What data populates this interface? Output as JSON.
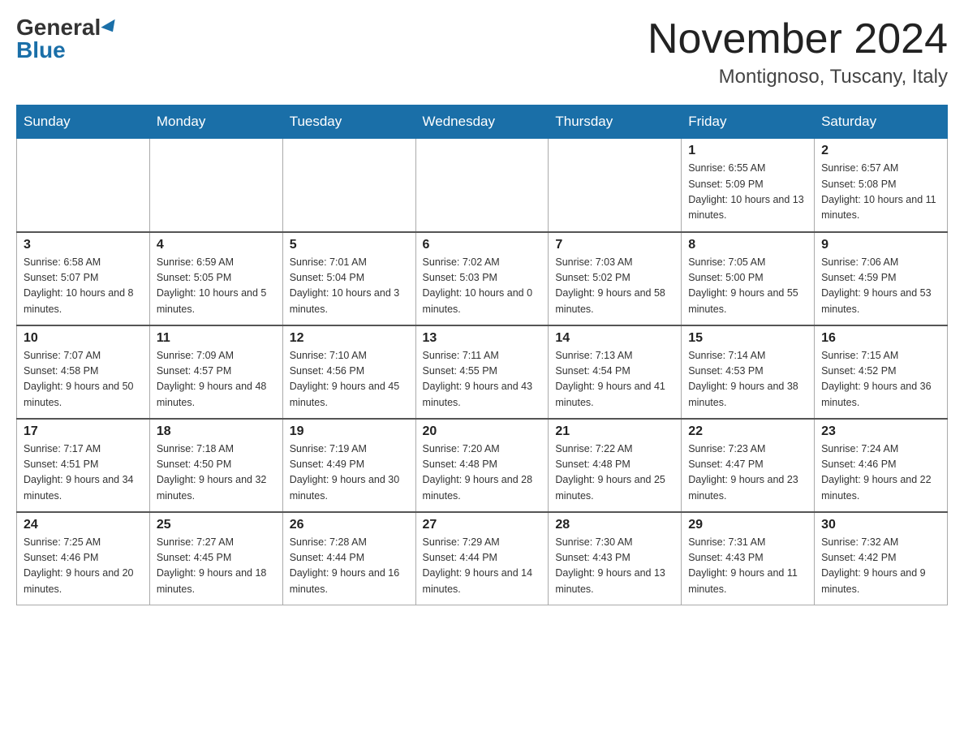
{
  "header": {
    "logo_general": "General",
    "logo_blue": "Blue",
    "month_title": "November 2024",
    "location": "Montignoso, Tuscany, Italy"
  },
  "days_of_week": [
    "Sunday",
    "Monday",
    "Tuesday",
    "Wednesday",
    "Thursday",
    "Friday",
    "Saturday"
  ],
  "weeks": [
    [
      {
        "day": "",
        "sunrise": "",
        "sunset": "",
        "daylight": ""
      },
      {
        "day": "",
        "sunrise": "",
        "sunset": "",
        "daylight": ""
      },
      {
        "day": "",
        "sunrise": "",
        "sunset": "",
        "daylight": ""
      },
      {
        "day": "",
        "sunrise": "",
        "sunset": "",
        "daylight": ""
      },
      {
        "day": "",
        "sunrise": "",
        "sunset": "",
        "daylight": ""
      },
      {
        "day": "1",
        "sunrise": "Sunrise: 6:55 AM",
        "sunset": "Sunset: 5:09 PM",
        "daylight": "Daylight: 10 hours and 13 minutes."
      },
      {
        "day": "2",
        "sunrise": "Sunrise: 6:57 AM",
        "sunset": "Sunset: 5:08 PM",
        "daylight": "Daylight: 10 hours and 11 minutes."
      }
    ],
    [
      {
        "day": "3",
        "sunrise": "Sunrise: 6:58 AM",
        "sunset": "Sunset: 5:07 PM",
        "daylight": "Daylight: 10 hours and 8 minutes."
      },
      {
        "day": "4",
        "sunrise": "Sunrise: 6:59 AM",
        "sunset": "Sunset: 5:05 PM",
        "daylight": "Daylight: 10 hours and 5 minutes."
      },
      {
        "day": "5",
        "sunrise": "Sunrise: 7:01 AM",
        "sunset": "Sunset: 5:04 PM",
        "daylight": "Daylight: 10 hours and 3 minutes."
      },
      {
        "day": "6",
        "sunrise": "Sunrise: 7:02 AM",
        "sunset": "Sunset: 5:03 PM",
        "daylight": "Daylight: 10 hours and 0 minutes."
      },
      {
        "day": "7",
        "sunrise": "Sunrise: 7:03 AM",
        "sunset": "Sunset: 5:02 PM",
        "daylight": "Daylight: 9 hours and 58 minutes."
      },
      {
        "day": "8",
        "sunrise": "Sunrise: 7:05 AM",
        "sunset": "Sunset: 5:00 PM",
        "daylight": "Daylight: 9 hours and 55 minutes."
      },
      {
        "day": "9",
        "sunrise": "Sunrise: 7:06 AM",
        "sunset": "Sunset: 4:59 PM",
        "daylight": "Daylight: 9 hours and 53 minutes."
      }
    ],
    [
      {
        "day": "10",
        "sunrise": "Sunrise: 7:07 AM",
        "sunset": "Sunset: 4:58 PM",
        "daylight": "Daylight: 9 hours and 50 minutes."
      },
      {
        "day": "11",
        "sunrise": "Sunrise: 7:09 AM",
        "sunset": "Sunset: 4:57 PM",
        "daylight": "Daylight: 9 hours and 48 minutes."
      },
      {
        "day": "12",
        "sunrise": "Sunrise: 7:10 AM",
        "sunset": "Sunset: 4:56 PM",
        "daylight": "Daylight: 9 hours and 45 minutes."
      },
      {
        "day": "13",
        "sunrise": "Sunrise: 7:11 AM",
        "sunset": "Sunset: 4:55 PM",
        "daylight": "Daylight: 9 hours and 43 minutes."
      },
      {
        "day": "14",
        "sunrise": "Sunrise: 7:13 AM",
        "sunset": "Sunset: 4:54 PM",
        "daylight": "Daylight: 9 hours and 41 minutes."
      },
      {
        "day": "15",
        "sunrise": "Sunrise: 7:14 AM",
        "sunset": "Sunset: 4:53 PM",
        "daylight": "Daylight: 9 hours and 38 minutes."
      },
      {
        "day": "16",
        "sunrise": "Sunrise: 7:15 AM",
        "sunset": "Sunset: 4:52 PM",
        "daylight": "Daylight: 9 hours and 36 minutes."
      }
    ],
    [
      {
        "day": "17",
        "sunrise": "Sunrise: 7:17 AM",
        "sunset": "Sunset: 4:51 PM",
        "daylight": "Daylight: 9 hours and 34 minutes."
      },
      {
        "day": "18",
        "sunrise": "Sunrise: 7:18 AM",
        "sunset": "Sunset: 4:50 PM",
        "daylight": "Daylight: 9 hours and 32 minutes."
      },
      {
        "day": "19",
        "sunrise": "Sunrise: 7:19 AM",
        "sunset": "Sunset: 4:49 PM",
        "daylight": "Daylight: 9 hours and 30 minutes."
      },
      {
        "day": "20",
        "sunrise": "Sunrise: 7:20 AM",
        "sunset": "Sunset: 4:48 PM",
        "daylight": "Daylight: 9 hours and 28 minutes."
      },
      {
        "day": "21",
        "sunrise": "Sunrise: 7:22 AM",
        "sunset": "Sunset: 4:48 PM",
        "daylight": "Daylight: 9 hours and 25 minutes."
      },
      {
        "day": "22",
        "sunrise": "Sunrise: 7:23 AM",
        "sunset": "Sunset: 4:47 PM",
        "daylight": "Daylight: 9 hours and 23 minutes."
      },
      {
        "day": "23",
        "sunrise": "Sunrise: 7:24 AM",
        "sunset": "Sunset: 4:46 PM",
        "daylight": "Daylight: 9 hours and 22 minutes."
      }
    ],
    [
      {
        "day": "24",
        "sunrise": "Sunrise: 7:25 AM",
        "sunset": "Sunset: 4:46 PM",
        "daylight": "Daylight: 9 hours and 20 minutes."
      },
      {
        "day": "25",
        "sunrise": "Sunrise: 7:27 AM",
        "sunset": "Sunset: 4:45 PM",
        "daylight": "Daylight: 9 hours and 18 minutes."
      },
      {
        "day": "26",
        "sunrise": "Sunrise: 7:28 AM",
        "sunset": "Sunset: 4:44 PM",
        "daylight": "Daylight: 9 hours and 16 minutes."
      },
      {
        "day": "27",
        "sunrise": "Sunrise: 7:29 AM",
        "sunset": "Sunset: 4:44 PM",
        "daylight": "Daylight: 9 hours and 14 minutes."
      },
      {
        "day": "28",
        "sunrise": "Sunrise: 7:30 AM",
        "sunset": "Sunset: 4:43 PM",
        "daylight": "Daylight: 9 hours and 13 minutes."
      },
      {
        "day": "29",
        "sunrise": "Sunrise: 7:31 AM",
        "sunset": "Sunset: 4:43 PM",
        "daylight": "Daylight: 9 hours and 11 minutes."
      },
      {
        "day": "30",
        "sunrise": "Sunrise: 7:32 AM",
        "sunset": "Sunset: 4:42 PM",
        "daylight": "Daylight: 9 hours and 9 minutes."
      }
    ]
  ]
}
